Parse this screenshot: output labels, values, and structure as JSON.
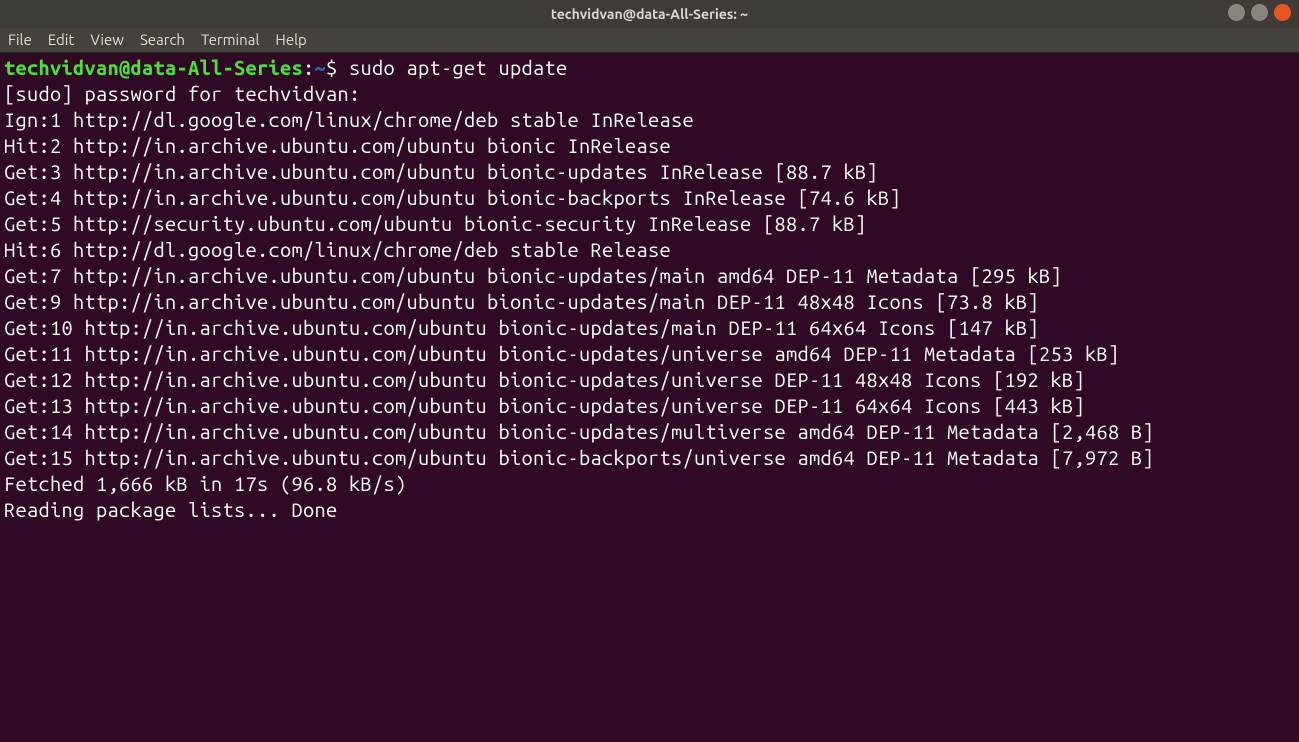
{
  "window": {
    "title": "techvidvan@data-All-Series: ~"
  },
  "menu": {
    "file": "File",
    "edit": "Edit",
    "view": "View",
    "search": "Search",
    "terminal": "Terminal",
    "help": "Help"
  },
  "prompt": {
    "user_host": "techvidvan@data-All-Series",
    "sep": ":",
    "path": "~",
    "dollar": "$ ",
    "command": "sudo apt-get update"
  },
  "lines": {
    "l1": "[sudo] password for techvidvan:",
    "l2": "Ign:1 http://dl.google.com/linux/chrome/deb stable InRelease",
    "l3": "Hit:2 http://in.archive.ubuntu.com/ubuntu bionic InRelease",
    "l4": "Get:3 http://in.archive.ubuntu.com/ubuntu bionic-updates InRelease [88.7 kB]",
    "l5": "Get:4 http://in.archive.ubuntu.com/ubuntu bionic-backports InRelease [74.6 kB]",
    "l6": "Get:5 http://security.ubuntu.com/ubuntu bionic-security InRelease [88.7 kB]",
    "l7": "Hit:6 http://dl.google.com/linux/chrome/deb stable Release",
    "l8": "Get:7 http://in.archive.ubuntu.com/ubuntu bionic-updates/main amd64 DEP-11 Metadata [295 kB]",
    "l9": "Get:9 http://in.archive.ubuntu.com/ubuntu bionic-updates/main DEP-11 48x48 Icons [73.8 kB]",
    "l10": "Get:10 http://in.archive.ubuntu.com/ubuntu bionic-updates/main DEP-11 64x64 Icons [147 kB]",
    "l11": "Get:11 http://in.archive.ubuntu.com/ubuntu bionic-updates/universe amd64 DEP-11 Metadata [253 kB]",
    "l12": "Get:12 http://in.archive.ubuntu.com/ubuntu bionic-updates/universe DEP-11 48x48 Icons [192 kB]",
    "l13": "Get:13 http://in.archive.ubuntu.com/ubuntu bionic-updates/universe DEP-11 64x64 Icons [443 kB]",
    "l14": "Get:14 http://in.archive.ubuntu.com/ubuntu bionic-updates/multiverse amd64 DEP-11 Metadata [2,468 B]",
    "l15": "Get:15 http://in.archive.ubuntu.com/ubuntu bionic-backports/universe amd64 DEP-11 Metadata [7,972 B]",
    "l16": "Fetched 1,666 kB in 17s (96.8 kB/s)",
    "l17": "Reading package lists... Done"
  }
}
